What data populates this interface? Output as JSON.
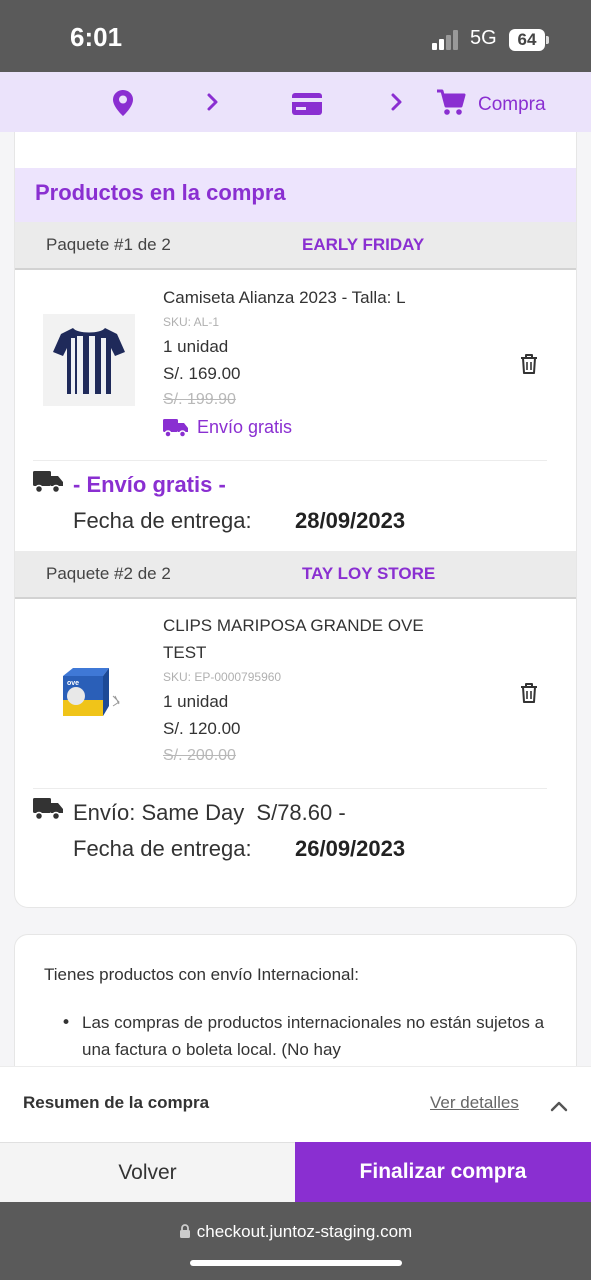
{
  "status_bar": {
    "time": "6:01",
    "network": "5G",
    "battery": "64"
  },
  "stepper": {
    "icons": [
      "location-pin-icon",
      "chevron-right-icon",
      "credit-card-icon",
      "chevron-right-icon",
      "cart-icon"
    ],
    "active_label": "Compra"
  },
  "products_section": {
    "title": "Productos en la compra"
  },
  "packages": [
    {
      "label": "Paquete #1 de 2",
      "store": "EARLY FRIDAY",
      "product": {
        "name": "Camiseta Alianza 2023 - Talla: L",
        "sku": "SKU: AL-1",
        "quantity": "1 unidad",
        "price": "S/. 169.00",
        "old_price": "S/. 199.90",
        "shipping_badge": "Envío gratis"
      },
      "shipping": {
        "text": "- Envío gratis -",
        "date_label": "Fecha de entrega:",
        "date": "28/09/2023"
      }
    },
    {
      "label": "Paquete #2 de 2",
      "store": "TAY LOY STORE",
      "product": {
        "name": "CLIPS MARIPOSA GRANDE OVE TEST",
        "sku": "SKU: EP-0000795960",
        "quantity": "1 unidad",
        "price": "S/. 120.00",
        "old_price": "S/. 200.00"
      },
      "shipping": {
        "text": "Envío: Same Day  S/78.60 -",
        "date_label": "Fecha de entrega:",
        "date": "26/09/2023"
      }
    }
  ],
  "international": {
    "title": "Tienes productos con envío Internacional:",
    "bullet": "Las compras de productos internacionales no están sujetos a una factura o boleta local. (No hay"
  },
  "summary": {
    "label": "Resumen de la compra",
    "link": "Ver detalles"
  },
  "actions": {
    "back": "Volver",
    "finish": "Finalizar compra"
  },
  "browser": {
    "url": "checkout.juntoz-staging.com"
  },
  "colors": {
    "accent": "#8a2fd1",
    "accent_light": "#ede4fd",
    "status_bar": "#5a5a5a"
  }
}
